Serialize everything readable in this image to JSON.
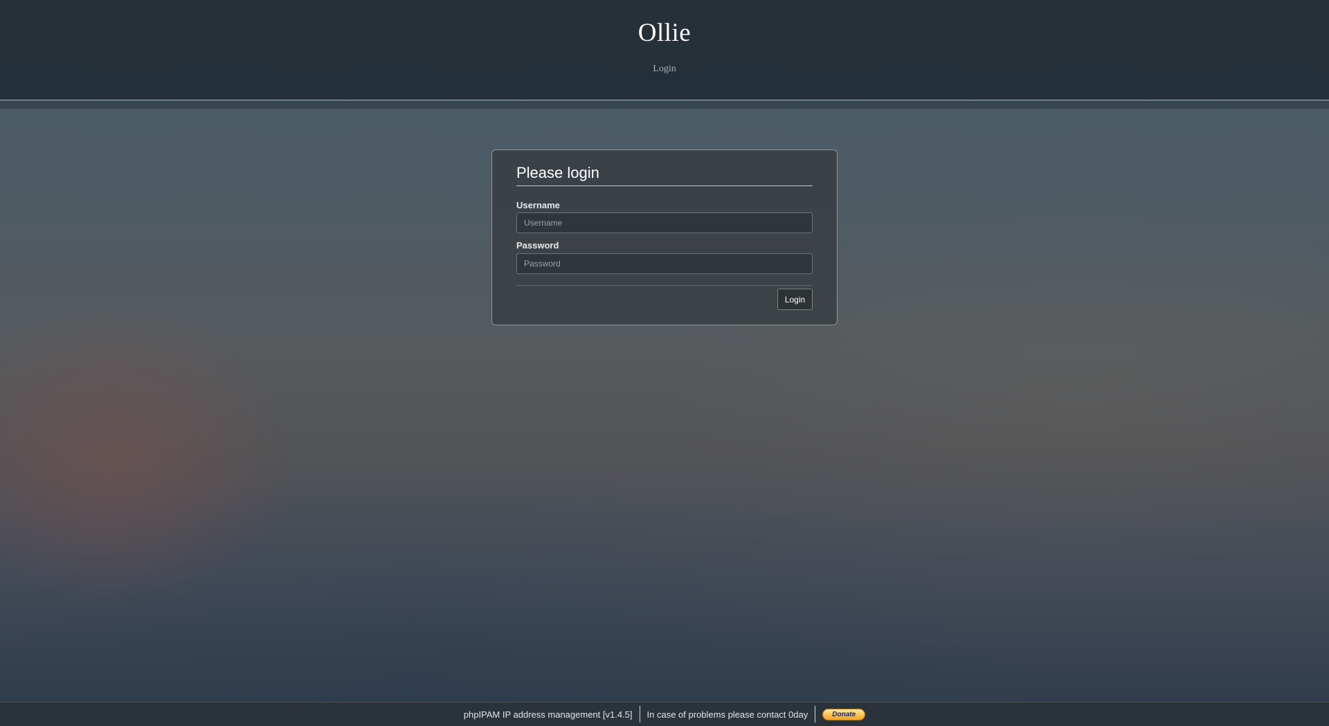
{
  "header": {
    "title": "Ollie",
    "subtitle": "Login"
  },
  "login_form": {
    "heading": "Please login",
    "username_label": "Username",
    "username_placeholder": "Username",
    "username_value": "",
    "password_label": "Password",
    "password_placeholder": "Password",
    "password_value": "",
    "submit_label": "Login"
  },
  "footer": {
    "app_info": "phpIPAM IP address management [v1.4.5]",
    "contact": "In case of problems please contact 0day",
    "donate_label": "Donate"
  },
  "colors": {
    "header_bg": "#263039",
    "box_bg": "#383e42",
    "donate_gold": "#fbc14f",
    "donate_text": "#1b2a5e"
  }
}
